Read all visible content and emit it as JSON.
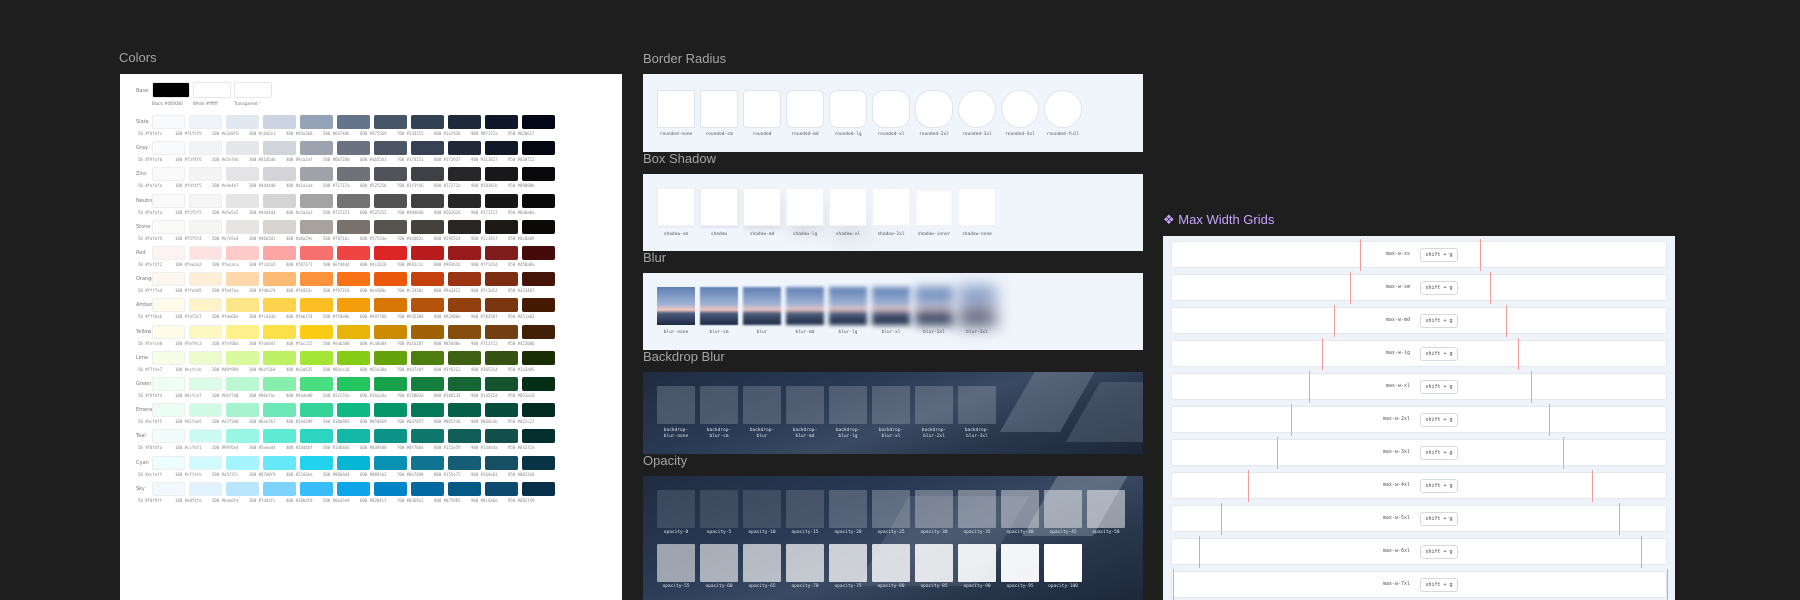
{
  "titles": {
    "colors": "Colors",
    "border_radius": "Border Radius",
    "box_shadow": "Box Shadow",
    "blur": "Blur",
    "backdrop_blur": "Backdrop Blur",
    "opacity": "Opacity",
    "max_width": "Max Width Grids",
    "max_width_icon": "component-icon"
  },
  "base": {
    "label": "Base",
    "swatches": [
      {
        "name": "Black",
        "hex": "#000000",
        "color": "#000000"
      },
      {
        "name": "White",
        "hex": "#ffffff",
        "color": "#ffffff"
      },
      {
        "name": "Transparent",
        "hex": "-",
        "color": "transparent"
      }
    ]
  },
  "color_rows": [
    {
      "name": "Slate",
      "colors": [
        "#f8fafc",
        "#f1f5f9",
        "#e2e8f0",
        "#cbd5e1",
        "#94a3b8",
        "#64748b",
        "#475569",
        "#334155",
        "#1e293b",
        "#0f172a",
        "#020617"
      ]
    },
    {
      "name": "Gray",
      "colors": [
        "#f9fafb",
        "#f3f4f6",
        "#e5e7eb",
        "#d1d5db",
        "#9ca3af",
        "#6b7280",
        "#4b5563",
        "#374151",
        "#1f2937",
        "#111827",
        "#030712"
      ]
    },
    {
      "name": "Zinc",
      "colors": [
        "#fafafa",
        "#f4f4f5",
        "#e4e4e7",
        "#d4d4d8",
        "#a1a1aa",
        "#71717a",
        "#52525b",
        "#3f3f46",
        "#27272a",
        "#18181b",
        "#09090b"
      ]
    },
    {
      "name": "Neutral",
      "colors": [
        "#fafafa",
        "#f5f5f5",
        "#e5e5e5",
        "#d4d4d4",
        "#a3a3a3",
        "#737373",
        "#525252",
        "#404040",
        "#262626",
        "#171717",
        "#0a0a0a"
      ]
    },
    {
      "name": "Stone",
      "colors": [
        "#fafaf9",
        "#f5f5f4",
        "#e7e5e4",
        "#d6d3d1",
        "#a8a29e",
        "#78716c",
        "#57534e",
        "#44403c",
        "#292524",
        "#1c1917",
        "#0c0a09"
      ]
    },
    {
      "name": "Red",
      "colors": [
        "#fef2f2",
        "#fee2e2",
        "#fecaca",
        "#fca5a5",
        "#f87171",
        "#ef4444",
        "#dc2626",
        "#b91c1c",
        "#991b1b",
        "#7f1d1d",
        "#450a0a"
      ]
    },
    {
      "name": "Orange",
      "colors": [
        "#fff7ed",
        "#ffedd5",
        "#fed7aa",
        "#fdba74",
        "#fb923c",
        "#f97316",
        "#ea580c",
        "#c2410c",
        "#9a3412",
        "#7c2d12",
        "#431407"
      ]
    },
    {
      "name": "Amber",
      "colors": [
        "#fffbeb",
        "#fef3c7",
        "#fde68a",
        "#fcd34d",
        "#fbbf24",
        "#f59e0b",
        "#d97706",
        "#b45309",
        "#92400e",
        "#78350f",
        "#451a03"
      ]
    },
    {
      "name": "Yellow",
      "colors": [
        "#fefce8",
        "#fef9c3",
        "#fef08a",
        "#fde047",
        "#facc15",
        "#eab308",
        "#ca8a04",
        "#a16207",
        "#854d0e",
        "#713f12",
        "#422006"
      ]
    },
    {
      "name": "Lime",
      "colors": [
        "#f7fee7",
        "#ecfccb",
        "#d9f99d",
        "#bef264",
        "#a3e635",
        "#84cc16",
        "#65a30d",
        "#4d7c0f",
        "#3f6212",
        "#365314",
        "#1a2e05"
      ]
    },
    {
      "name": "Green",
      "colors": [
        "#f0fdf4",
        "#dcfce7",
        "#bbf7d0",
        "#86efac",
        "#4ade80",
        "#22c55e",
        "#16a34a",
        "#15803d",
        "#166534",
        "#14532d",
        "#052e16"
      ]
    },
    {
      "name": "Emerald",
      "colors": [
        "#ecfdf5",
        "#d1fae5",
        "#a7f3d0",
        "#6ee7b7",
        "#34d399",
        "#10b981",
        "#059669",
        "#047857",
        "#065f46",
        "#064e3b",
        "#022c22"
      ]
    },
    {
      "name": "Teal",
      "colors": [
        "#f0fdfa",
        "#ccfbf1",
        "#99f6e4",
        "#5eead4",
        "#2dd4bf",
        "#14b8a6",
        "#0d9488",
        "#0f766e",
        "#115e59",
        "#134e4a",
        "#042f2e"
      ]
    },
    {
      "name": "Cyan",
      "colors": [
        "#ecfeff",
        "#cffafe",
        "#a5f3fc",
        "#67e8f9",
        "#22d3ee",
        "#06b6d4",
        "#0891b2",
        "#0e7490",
        "#155e75",
        "#164e63",
        "#083344"
      ]
    },
    {
      "name": "Sky",
      "colors": [
        "#f0f9ff",
        "#e0f2fe",
        "#bae6fd",
        "#7dd3fc",
        "#38bdf8",
        "#0ea5e9",
        "#0284c7",
        "#0369a1",
        "#075985",
        "#0c4a6e",
        "#082f49"
      ]
    }
  ],
  "shades": [
    "50",
    "100",
    "200",
    "300",
    "400",
    "500",
    "600",
    "700",
    "800",
    "900",
    "950"
  ],
  "border_radius": [
    "rounded-none",
    "rounded-sm",
    "rounded",
    "rounded-md",
    "rounded-lg",
    "rounded-xl",
    "rounded-2xl",
    "rounded-3xl",
    "rounded-4xl",
    "rounded-full"
  ],
  "box_shadow": [
    "shadow-sm",
    "shadow",
    "shadow-md",
    "shadow-lg",
    "shadow-xl",
    "shadow-2xl",
    "shadow-inner",
    "shadow-none"
  ],
  "blur": [
    "blur-none",
    "blur-sm",
    "blur",
    "blur-md",
    "blur-lg",
    "blur-xl",
    "blur-2xl",
    "blur-3xl"
  ],
  "backdrop_blur": [
    "backdrop-\nblur-none",
    "backdrop-\nblur-sm",
    "backdrop-\nblur",
    "backdrop-\nblur-md",
    "backdrop-\nblur-lg",
    "backdrop-\nblur-xl",
    "backdrop-\nblur-2xl",
    "backdrop-\nblur-3xl"
  ],
  "opacity": [
    [
      "opacity-0",
      "opacity-5",
      "opacity-10",
      "opacity-15",
      "opacity-20",
      "opacity-25",
      "opacity-30",
      "opacity-35",
      "opacity-40",
      "opacity-45",
      "opacity-50"
    ],
    [
      "opacity-55",
      "opacity-60",
      "opacity-65",
      "opacity-70",
      "opacity-75",
      "opacity-80",
      "opacity-85",
      "opacity-90",
      "opacity-95",
      "opacity-100"
    ]
  ],
  "max_width": {
    "shortcut": "shift + g",
    "rows": [
      "max-w-xs",
      "max-w-sm",
      "max-w-md",
      "max-w-lg",
      "max-w-xl",
      "max-w-2xl",
      "max-w-3xl",
      "max-w-4xl",
      "max-w-5xl",
      "max-w-6xl",
      "max-w-7xl"
    ]
  },
  "colors_meta": {
    "accent_purple": "#c7a6ff",
    "grid_line": "#f29d9d"
  }
}
